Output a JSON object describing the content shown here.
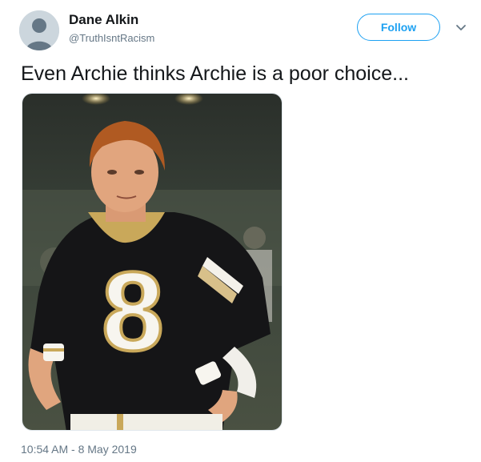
{
  "tweet": {
    "author": {
      "display_name": "Dane Alkin",
      "handle": "@TruthIsntRacism"
    },
    "follow_label": "Follow",
    "text": "Even Archie thinks Archie is a poor choice...",
    "timestamp": "10:54 AM - 8 May 2019",
    "media": {
      "jersey_number": "8"
    }
  },
  "colors": {
    "accent": "#1da1f2",
    "secondary_text": "#657786",
    "primary_text": "#14171a"
  },
  "icons": {
    "avatar": "default-avatar-icon",
    "more": "chevron-down-icon"
  }
}
